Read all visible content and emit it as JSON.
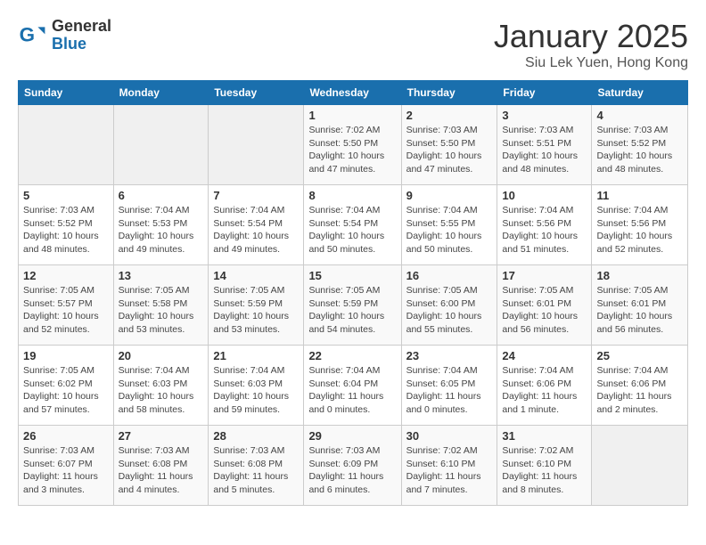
{
  "header": {
    "logo_general": "General",
    "logo_blue": "Blue",
    "month_title": "January 2025",
    "location": "Siu Lek Yuen, Hong Kong"
  },
  "weekdays": [
    "Sunday",
    "Monday",
    "Tuesday",
    "Wednesday",
    "Thursday",
    "Friday",
    "Saturday"
  ],
  "weeks": [
    [
      {
        "day": "",
        "info": ""
      },
      {
        "day": "",
        "info": ""
      },
      {
        "day": "",
        "info": ""
      },
      {
        "day": "1",
        "info": "Sunrise: 7:02 AM\nSunset: 5:50 PM\nDaylight: 10 hours\nand 47 minutes."
      },
      {
        "day": "2",
        "info": "Sunrise: 7:03 AM\nSunset: 5:50 PM\nDaylight: 10 hours\nand 47 minutes."
      },
      {
        "day": "3",
        "info": "Sunrise: 7:03 AM\nSunset: 5:51 PM\nDaylight: 10 hours\nand 48 minutes."
      },
      {
        "day": "4",
        "info": "Sunrise: 7:03 AM\nSunset: 5:52 PM\nDaylight: 10 hours\nand 48 minutes."
      }
    ],
    [
      {
        "day": "5",
        "info": "Sunrise: 7:03 AM\nSunset: 5:52 PM\nDaylight: 10 hours\nand 48 minutes."
      },
      {
        "day": "6",
        "info": "Sunrise: 7:04 AM\nSunset: 5:53 PM\nDaylight: 10 hours\nand 49 minutes."
      },
      {
        "day": "7",
        "info": "Sunrise: 7:04 AM\nSunset: 5:54 PM\nDaylight: 10 hours\nand 49 minutes."
      },
      {
        "day": "8",
        "info": "Sunrise: 7:04 AM\nSunset: 5:54 PM\nDaylight: 10 hours\nand 50 minutes."
      },
      {
        "day": "9",
        "info": "Sunrise: 7:04 AM\nSunset: 5:55 PM\nDaylight: 10 hours\nand 50 minutes."
      },
      {
        "day": "10",
        "info": "Sunrise: 7:04 AM\nSunset: 5:56 PM\nDaylight: 10 hours\nand 51 minutes."
      },
      {
        "day": "11",
        "info": "Sunrise: 7:04 AM\nSunset: 5:56 PM\nDaylight: 10 hours\nand 52 minutes."
      }
    ],
    [
      {
        "day": "12",
        "info": "Sunrise: 7:05 AM\nSunset: 5:57 PM\nDaylight: 10 hours\nand 52 minutes."
      },
      {
        "day": "13",
        "info": "Sunrise: 7:05 AM\nSunset: 5:58 PM\nDaylight: 10 hours\nand 53 minutes."
      },
      {
        "day": "14",
        "info": "Sunrise: 7:05 AM\nSunset: 5:59 PM\nDaylight: 10 hours\nand 53 minutes."
      },
      {
        "day": "15",
        "info": "Sunrise: 7:05 AM\nSunset: 5:59 PM\nDaylight: 10 hours\nand 54 minutes."
      },
      {
        "day": "16",
        "info": "Sunrise: 7:05 AM\nSunset: 6:00 PM\nDaylight: 10 hours\nand 55 minutes."
      },
      {
        "day": "17",
        "info": "Sunrise: 7:05 AM\nSunset: 6:01 PM\nDaylight: 10 hours\nand 56 minutes."
      },
      {
        "day": "18",
        "info": "Sunrise: 7:05 AM\nSunset: 6:01 PM\nDaylight: 10 hours\nand 56 minutes."
      }
    ],
    [
      {
        "day": "19",
        "info": "Sunrise: 7:05 AM\nSunset: 6:02 PM\nDaylight: 10 hours\nand 57 minutes."
      },
      {
        "day": "20",
        "info": "Sunrise: 7:04 AM\nSunset: 6:03 PM\nDaylight: 10 hours\nand 58 minutes."
      },
      {
        "day": "21",
        "info": "Sunrise: 7:04 AM\nSunset: 6:03 PM\nDaylight: 10 hours\nand 59 minutes."
      },
      {
        "day": "22",
        "info": "Sunrise: 7:04 AM\nSunset: 6:04 PM\nDaylight: 11 hours\nand 0 minutes."
      },
      {
        "day": "23",
        "info": "Sunrise: 7:04 AM\nSunset: 6:05 PM\nDaylight: 11 hours\nand 0 minutes."
      },
      {
        "day": "24",
        "info": "Sunrise: 7:04 AM\nSunset: 6:06 PM\nDaylight: 11 hours\nand 1 minute."
      },
      {
        "day": "25",
        "info": "Sunrise: 7:04 AM\nSunset: 6:06 PM\nDaylight: 11 hours\nand 2 minutes."
      }
    ],
    [
      {
        "day": "26",
        "info": "Sunrise: 7:03 AM\nSunset: 6:07 PM\nDaylight: 11 hours\nand 3 minutes."
      },
      {
        "day": "27",
        "info": "Sunrise: 7:03 AM\nSunset: 6:08 PM\nDaylight: 11 hours\nand 4 minutes."
      },
      {
        "day": "28",
        "info": "Sunrise: 7:03 AM\nSunset: 6:08 PM\nDaylight: 11 hours\nand 5 minutes."
      },
      {
        "day": "29",
        "info": "Sunrise: 7:03 AM\nSunset: 6:09 PM\nDaylight: 11 hours\nand 6 minutes."
      },
      {
        "day": "30",
        "info": "Sunrise: 7:02 AM\nSunset: 6:10 PM\nDaylight: 11 hours\nand 7 minutes."
      },
      {
        "day": "31",
        "info": "Sunrise: 7:02 AM\nSunset: 6:10 PM\nDaylight: 11 hours\nand 8 minutes."
      },
      {
        "day": "",
        "info": ""
      }
    ]
  ]
}
